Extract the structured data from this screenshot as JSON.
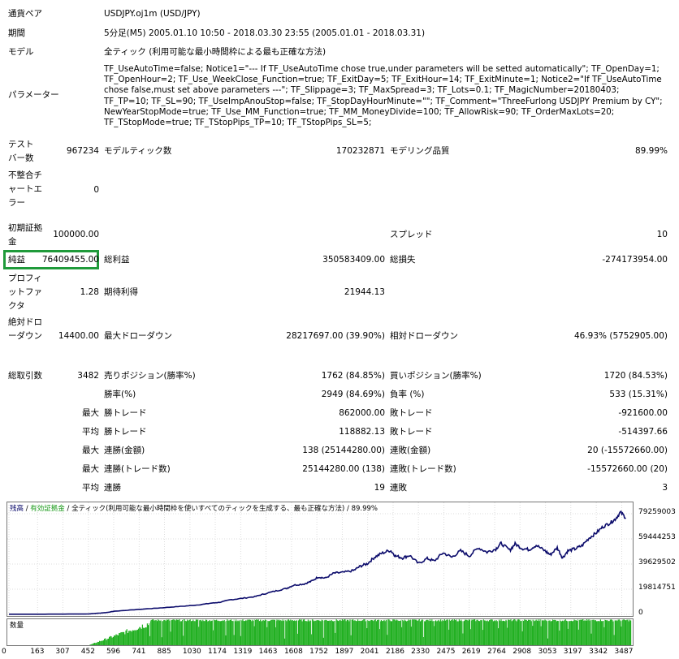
{
  "report": {
    "symbol_label": "通貨ペア",
    "symbol_value": "USDJPY.oj1m (USD/JPY)",
    "period_label": "期間",
    "period_value": "5分足(M5) 2005.01.10 10:50 - 2018.03.30 23:55 (2005.01.01 - 2018.03.31)",
    "model_label": "モデル",
    "model_value": "全ティック (利用可能な最小時間枠による最も正確な方法)",
    "params_label": "パラメーター",
    "params_value": "TF_UseAutoTime=false; Notice1=\"--- If TF_UseAutoTime chose true,under parameters will be setted automatically\"; TF_OpenDay=1; TF_OpenHour=2; TF_Use_WeekClose_Function=true; TF_ExitDay=5; TF_ExitHour=14; TF_ExitMinute=1; Notice2=\"If TF_UseAutoTime chose false,must set above parameters ---\"; TF_Slippage=3; TF_MaxSpread=3; TF_Lots=0.1; TF_MagicNumber=20180403; TF_TP=10; TF_SL=90; TF_UseImpAnouStop=false; TF_StopDayHourMinute=\"\"; TF_Comment=\"ThreeFurlong USDJPY Premium by CY\"; NewYearStopMode=true; TF_Use_MM_Function=true; TF_MM_MoneyDivide=100; TF_AllowRisk=90; TF_OrderMaxLots=20; TF_TStopMode=true; TF_TStopPips_TP=10; TF_TStopPips_SL=5;",
    "bars_label": "テストバー数",
    "bars_value": "967234",
    "ticks_label": "モデルティック数",
    "ticks_value": "170232871",
    "quality_label": "モデリング品質",
    "quality_value": "89.99%",
    "mismatch_label": "不整合チャートエラー",
    "mismatch_value": "0",
    "deposit_label": "初期証拠金",
    "deposit_value": "100000.00",
    "spread_label": "スプレッド",
    "spread_value": "10",
    "net_label": "純益",
    "net_value": "76409455.00",
    "gross_profit_label": "総利益",
    "gross_profit_value": "350583409.00",
    "gross_loss_label": "総損失",
    "gross_loss_value": "-274173954.00",
    "pf_label": "プロフィットファクタ",
    "pf_value": "1.28",
    "expected_label": "期待利得",
    "expected_value": "21944.13",
    "abs_dd_label": "絶対ドローダウン",
    "abs_dd_value": "14400.00",
    "max_dd_label": "最大ドローダウン",
    "max_dd_value": "28217697.00 (39.90%)",
    "rel_dd_label": "相対ドローダウン",
    "rel_dd_value": "46.93% (5752905.00)",
    "total_trades_label": "総取引数",
    "total_trades_value": "3482",
    "short_label": "売りポジション(勝率%)",
    "short_value": "1762 (84.85%)",
    "long_label": "買いポジション(勝率%)",
    "long_value": "1720 (84.53%)",
    "win_pct_label": "勝率(%)",
    "win_pct_value": "2949 (84.69%)",
    "loss_pct_label": "負率 (%)",
    "loss_pct_value": "533 (15.31%)",
    "max_label": "最大",
    "avg_label": "平均",
    "largest_win_label": "勝トレード",
    "largest_win_value": "862000.00",
    "largest_loss_label": "敗トレード",
    "largest_loss_value": "-921600.00",
    "avg_win_label": "勝トレード",
    "avg_win_value": "118882.13",
    "avg_loss_label": "敗トレード",
    "avg_loss_value": "-514397.66",
    "max_cons_wins_label": "連勝(金額)",
    "max_cons_wins_value": "138 (25144280.00)",
    "max_cons_losses_label": "連敗(金額)",
    "max_cons_losses_value": "20 (-15572660.00)",
    "max_cons_profit_label": "連勝(トレード数)",
    "max_cons_profit_value": "25144280.00 (138)",
    "max_cons_loss_label": "連敗(トレード数)",
    "max_cons_loss_value": "-15572660.00 (20)",
    "avg_cons_wins_label": "連勝",
    "avg_cons_wins_value": "19",
    "avg_cons_losses_label": "連敗",
    "avg_cons_losses_value": "3"
  },
  "chart_legend": {
    "balance": "残高",
    "sep1": " / ",
    "equity": "有効証拠金",
    "sep2": " / ",
    "model": "全ティック(利用可能な最小時間枠を使いすべてのティックを生成する、最も正確な方法)",
    "sep3": " / ",
    "quality": "89.99%"
  },
  "volume_label": "数量",
  "colors": {
    "balance": "#0b0b6b",
    "equity": "#1a9a1a",
    "volume": "#22b022",
    "highlight": "#1f9a3a"
  },
  "chart_data": {
    "type": "line",
    "y_ticks": [
      "79259003",
      "59444253",
      "39629502",
      "19814751",
      "0"
    ],
    "ylim": [
      0,
      79259003
    ],
    "x_ticks": [
      "0",
      "163",
      "307",
      "452",
      "596",
      "741",
      "885",
      "1030",
      "1174",
      "1319",
      "1463",
      "1608",
      "1752",
      "1897",
      "2041",
      "2186",
      "2330",
      "2475",
      "2619",
      "2764",
      "2908",
      "3053",
      "3197",
      "3342",
      "3487"
    ],
    "xlim": [
      0,
      3540
    ],
    "series": [
      {
        "values_x": [
          0,
          150,
          300,
          452,
          500,
          560,
          600,
          700,
          800,
          900,
          1000,
          1080,
          1150,
          1200,
          1260,
          1320,
          1400,
          1450,
          1520,
          1580,
          1620,
          1680,
          1720,
          1760,
          1800,
          1850,
          1900,
          1960,
          2000,
          2040,
          2080,
          2120,
          2170,
          2200,
          2240,
          2280,
          2330,
          2380,
          2420,
          2470,
          2520,
          2570,
          2620,
          2670,
          2720,
          2770,
          2800,
          2850,
          2880,
          2920,
          2960,
          3000,
          3050,
          3080,
          3120,
          3150,
          3180,
          3220,
          3260,
          3300,
          3340,
          3380,
          3420,
          3450,
          3480,
          3510
        ],
        "values_y": [
          100000,
          120000,
          200000,
          300000,
          800000,
          1500000,
          2500000,
          3500000,
          4500000,
          5500000,
          6500000,
          7500000,
          8800000,
          9500000,
          11500000,
          12500000,
          14000000,
          16000000,
          18500000,
          20500000,
          23000000,
          24000000,
          26000000,
          29500000,
          28500000,
          32500000,
          33000000,
          34500000,
          38000000,
          40000000,
          45000000,
          48000000,
          50500000,
          46000000,
          44500000,
          46500000,
          40000000,
          44000000,
          42000000,
          48500000,
          45000000,
          50000000,
          46000000,
          52500000,
          49000000,
          51500000,
          56000000,
          50500000,
          55500000,
          52000000,
          51000000,
          54500000,
          50000000,
          47000000,
          52500000,
          44500000,
          50000000,
          51500000,
          54000000,
          60000000,
          64000000,
          69000000,
          72000000,
          75000000,
          80500000,
          76000000
        ]
      }
    ]
  }
}
